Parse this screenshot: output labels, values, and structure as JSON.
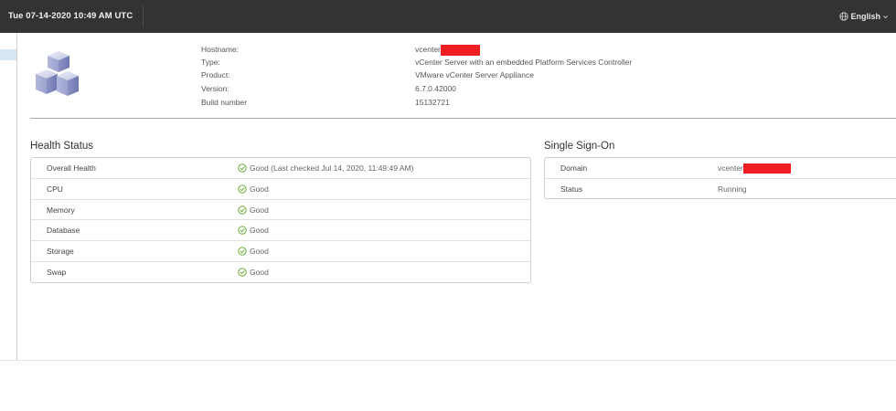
{
  "header": {
    "datetime": "Tue 07-14-2020 10:49 AM UTC",
    "language": "English",
    "icons": {
      "globe": "globe-icon",
      "chevron": "chevron-down-icon"
    }
  },
  "summary": {
    "product_icon": "vcenter-blocks-icon",
    "rows": [
      {
        "label": "Hostname:",
        "value": "vcenter",
        "redacted": true
      },
      {
        "label": "Type:",
        "value": "vCenter Server with an embedded Platform Services Controller"
      },
      {
        "label": "Product:",
        "value": "VMware vCenter Server Appliance"
      },
      {
        "label": "Version:",
        "value": "6.7.0.42000"
      },
      {
        "label": "Build number",
        "value": "15132721"
      }
    ]
  },
  "health": {
    "title": "Health Status",
    "rows": [
      {
        "label": "Overall Health",
        "status": "Good (Last checked Jul 14, 2020, 11:49:49 AM)"
      },
      {
        "label": "CPU",
        "status": "Good"
      },
      {
        "label": "Memory",
        "status": "Good"
      },
      {
        "label": "Database",
        "status": "Good"
      },
      {
        "label": "Storage",
        "status": "Good"
      },
      {
        "label": "Swap",
        "status": "Good"
      }
    ],
    "status_icon": "check-circle-icon",
    "status_color": "#5aa220"
  },
  "sso": {
    "title": "Single Sign-On",
    "rows": [
      {
        "label": "Domain",
        "value": "vcenter",
        "redacted": true
      },
      {
        "label": "Status",
        "value": "Running"
      }
    ]
  },
  "colors": {
    "topbar": "#333333",
    "redaction": "#ee1e23",
    "selection": "#d7e6f0"
  }
}
